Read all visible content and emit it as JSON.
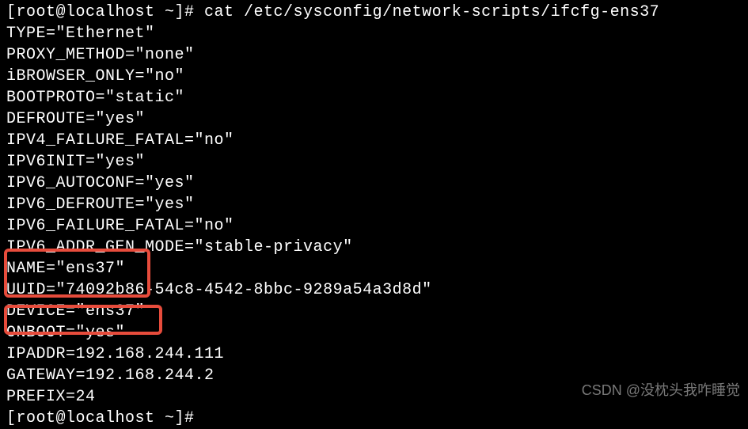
{
  "terminal": {
    "prompt_line": "[root@localhost ~]# cat /etc/sysconfig/network-scripts/ifcfg-ens37",
    "lines": [
      "TYPE=\"Ethernet\"",
      "PROXY_METHOD=\"none\"",
      "iBROWSER_ONLY=\"no\"",
      "BOOTPROTO=\"static\"",
      "DEFROUTE=\"yes\"",
      "IPV4_FAILURE_FATAL=\"no\"",
      "IPV6INIT=\"yes\"",
      "IPV6_AUTOCONF=\"yes\"",
      "IPV6_DEFROUTE=\"yes\"",
      "IPV6_FAILURE_FATAL=\"no\"",
      "IPV6_ADDR_GEN_MODE=\"stable-privacy\"",
      "NAME=\"ens37\"",
      "UUID=\"74092b86-54c8-4542-8bbc-9289a54a3d8d\"",
      "DEVICE=\"ens37\"",
      "ONBOOT=\"yes\"",
      "IPADDR=192.168.244.111",
      "GATEWAY=192.168.244.2",
      "PREFIX=24"
    ],
    "prompt_end": "[root@localhost ~]# "
  },
  "watermark": "CSDN @没枕头我咋睡觉"
}
